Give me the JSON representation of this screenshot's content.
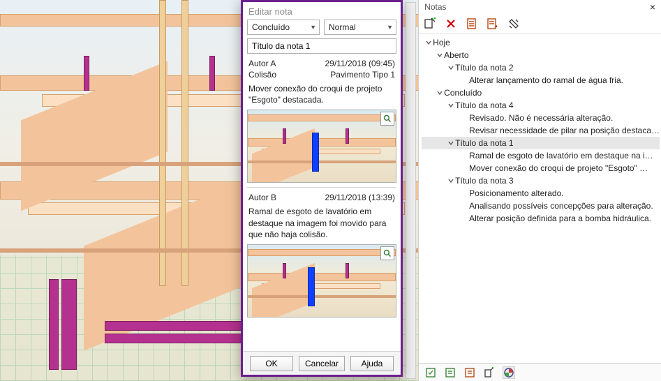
{
  "dialog": {
    "title": "Editar nota",
    "status_label": "Concluído",
    "priority_label": "Normal",
    "note_title": "Título da nota 1",
    "entries": [
      {
        "author": "Autor A",
        "timestamp": "29/11/2018 (09:45)",
        "tag": "Colisão",
        "location": "Pavimento Tipo 1",
        "text": "Mover conexão do croqui de projeto \"Esgoto\" destacada."
      },
      {
        "author": "Autor B",
        "timestamp": "29/11/2018 (13:39)",
        "text": "Ramal de esgoto de lavatório em destaque na imagem foi movido para que não haja colisão."
      }
    ],
    "buttons": {
      "ok": "OK",
      "cancel": "Cancelar",
      "help": "Ajuda"
    }
  },
  "panel": {
    "title": "Notas",
    "tree": {
      "hoje": "Hoje",
      "aberto": "Aberto",
      "concluido": "Concluído",
      "n2_title": "Título da nota 2",
      "n2_l1": "Alterar lançamento do ramal de água fria.",
      "n4_title": "Título da nota 4",
      "n4_l1": "Revisado. Não é necessária alteração.",
      "n4_l2": "Revisar necessidade de pilar na posição destaca…",
      "n1_title": "Título da nota 1",
      "n1_l1": "Ramal de esgoto de lavatório em destaque na i…",
      "n1_l2": "Mover conexão do croqui de projeto \"Esgoto\" …",
      "n3_title": "Título da nota 3",
      "n3_l1": "Posicionamento alterado.",
      "n3_l2": "Analisando possíveis concepções para alteração.",
      "n3_l3": "Alterar posição definida para a bomba hidráulica."
    }
  }
}
